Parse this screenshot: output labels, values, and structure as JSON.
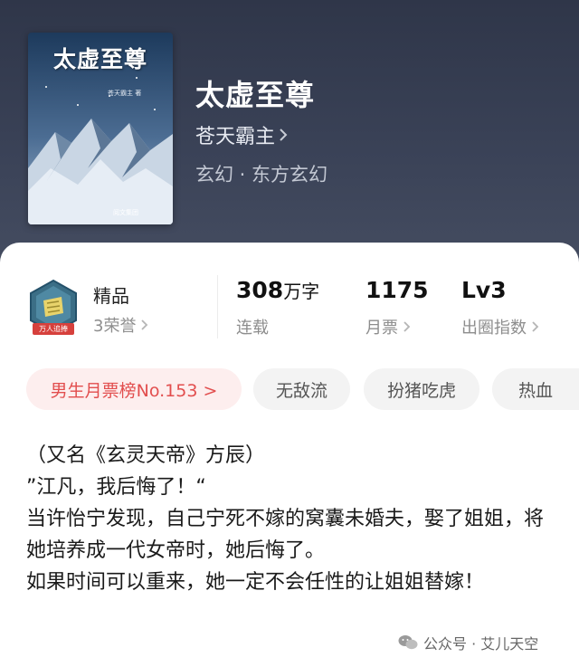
{
  "book": {
    "title": "太虚至尊",
    "author": "苍天霸主",
    "genre": "玄幻 · 东方玄幻",
    "cover": {
      "title": "太虚至尊",
      "author": "苍天霸主 著",
      "publisher": "阅文集团"
    }
  },
  "quality": {
    "label": "精品",
    "honors": "3荣誉",
    "badge_text": "万人追捧"
  },
  "stats": [
    {
      "value": "308",
      "unit": "万字",
      "label": "连载"
    },
    {
      "value": "1175",
      "unit": "",
      "label": "月票"
    },
    {
      "value": "Lv3",
      "unit": "",
      "label": "出圈指数"
    }
  ],
  "tags": [
    "男生月票榜No.153 >",
    "无敌流",
    "扮猪吃虎",
    "热血"
  ],
  "description": [
    "（又名《玄灵天帝》方辰）",
    "”江凡，我后悔了！“",
    "当许怡宁发现，自己宁死不嫁的窝囊未婚夫，娶了姐姐，将她培养成一代女帝时，她后悔了。",
    "如果时间可以重来，她一定不会任性的让姐姐替嫁！"
  ],
  "watermark": "公众号 · 艾儿天空",
  "colors": {
    "header_bg": "#383f53",
    "rank_tag_text": "#e24e4e",
    "rank_tag_bg": "#fdeeee"
  }
}
